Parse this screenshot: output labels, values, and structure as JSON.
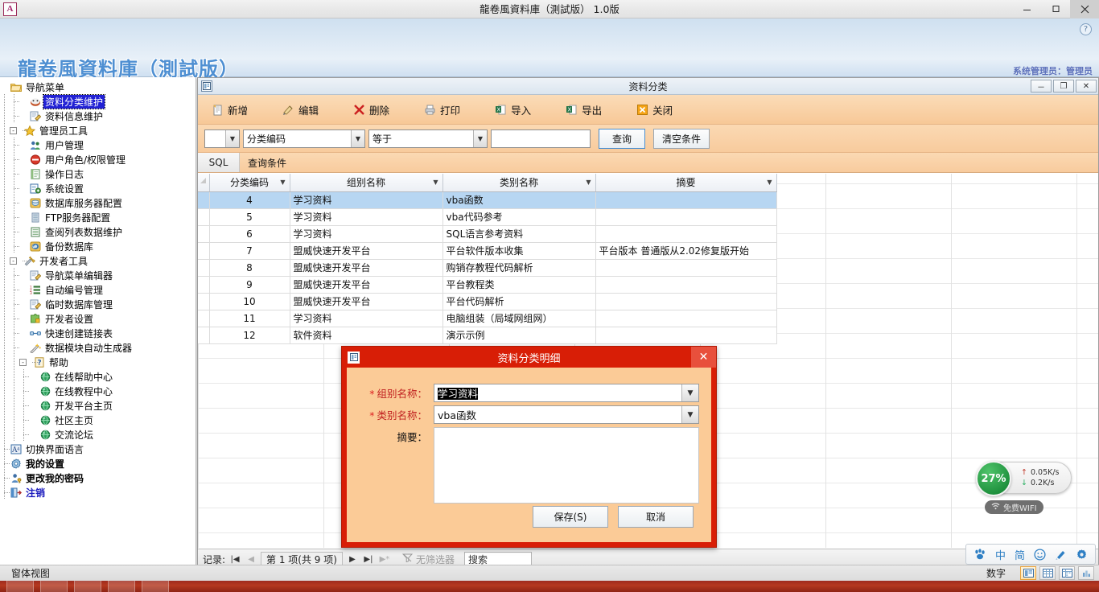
{
  "os_window": {
    "title": "龍卷風資料庫（測試版） 1.0版",
    "app_icon_letter": "A",
    "minimize_label": "最小化",
    "maximize_label": "最大化",
    "close_label": "关闭"
  },
  "app_header": {
    "title": "龍卷風資料庫（測試版）",
    "user_label": "系统管理员：管理员",
    "help_icon": "help-icon"
  },
  "nav": {
    "root": {
      "label": "导航菜单",
      "icon": "folder-icon"
    },
    "items": [
      {
        "label": "资料分类维护",
        "icon": "category-icon",
        "level": 1,
        "selected": true
      },
      {
        "label": "资料信息维护",
        "icon": "edit-doc-icon",
        "level": 1,
        "selected": false
      },
      {
        "label": "管理员工具",
        "icon": "star-icon",
        "level": 0,
        "group": true,
        "expander": "-"
      },
      {
        "label": "用户管理",
        "icon": "users-icon",
        "level": 1
      },
      {
        "label": "用户角色/权限管理",
        "icon": "forbidden-icon",
        "level": 1
      },
      {
        "label": "操作日志",
        "icon": "log-icon",
        "level": 1
      },
      {
        "label": "系统设置",
        "icon": "settings-doc-icon",
        "level": 1
      },
      {
        "label": "数据库服务器配置",
        "icon": "database-icon",
        "level": 1
      },
      {
        "label": "FTP服务器配置",
        "icon": "server-icon",
        "level": 1
      },
      {
        "label": "查阅列表数据维护",
        "icon": "list-icon",
        "level": 1
      },
      {
        "label": "备份数据库",
        "icon": "backup-icon",
        "level": 1
      },
      {
        "label": "开发者工具",
        "icon": "tools-icon",
        "level": 0,
        "group": true,
        "expander": "-"
      },
      {
        "label": "导航菜单编辑器",
        "icon": "edit-doc-icon",
        "level": 1
      },
      {
        "label": "自动编号管理",
        "icon": "number-list-icon",
        "level": 1
      },
      {
        "label": "临时数据库管理",
        "icon": "edit-doc-icon",
        "level": 1
      },
      {
        "label": "开发者设置",
        "icon": "puzzle-icon",
        "level": 1
      },
      {
        "label": "快速创建链接表",
        "icon": "link-icon",
        "level": 1
      },
      {
        "label": "数据模块自动生成器",
        "icon": "wand-icon",
        "level": 1
      },
      {
        "label": "帮助",
        "icon": "question-icon",
        "level": 1,
        "group": true,
        "expander": "-"
      },
      {
        "label": "在线帮助中心",
        "icon": "globe-icon",
        "level": 2
      },
      {
        "label": "在线教程中心",
        "icon": "globe-icon",
        "level": 2
      },
      {
        "label": "开发平台主页",
        "icon": "globe-icon",
        "level": 2
      },
      {
        "label": "社区主页",
        "icon": "globe-icon",
        "level": 2
      },
      {
        "label": "交流论坛",
        "icon": "globe-icon",
        "level": 2
      },
      {
        "label": "切换界面语言",
        "icon": "language-icon",
        "level": 0
      },
      {
        "label": "我的设置",
        "icon": "gear-icon",
        "level": 0,
        "bold": true
      },
      {
        "label": "更改我的密码",
        "icon": "user-key-icon",
        "level": 0,
        "bold": true
      },
      {
        "label": "注销",
        "icon": "logout-icon",
        "level": 0,
        "bold": true,
        "link": true
      }
    ]
  },
  "mdi": {
    "title": "资料分类",
    "icon": "form-icon",
    "minimize": "－",
    "restore": "❐",
    "close": "✕"
  },
  "toolbar": {
    "items": [
      {
        "label": "新增",
        "icon": "new-record-icon"
      },
      {
        "label": "编辑",
        "icon": "edit-icon"
      },
      {
        "label": "删除",
        "icon": "delete-icon"
      },
      {
        "label": "打印",
        "icon": "print-icon"
      },
      {
        "label": "导入",
        "icon": "import-excel-icon"
      },
      {
        "label": "导出",
        "icon": "export-excel-icon"
      },
      {
        "label": "关闭",
        "icon": "close-x-icon"
      }
    ]
  },
  "filterbar": {
    "logic_value": "",
    "field_value": "分类编码",
    "operator_value": "等于",
    "criteria_value": "",
    "criteria_placeholder": "",
    "query_button": "查询",
    "clear_button": "清空条件"
  },
  "sqlbar": {
    "tab_label": "SQL",
    "text": "查询条件"
  },
  "grid": {
    "columns": [
      "分类编码",
      "组别名称",
      "类别名称",
      "摘要"
    ],
    "rows": [
      {
        "cells": [
          "4",
          "学习资料",
          "vba函数",
          ""
        ],
        "selected": true
      },
      {
        "cells": [
          "5",
          "学习资料",
          "vba代码参考",
          ""
        ],
        "selected": false
      },
      {
        "cells": [
          "6",
          "学习资料",
          "SQL语言参考资料",
          ""
        ],
        "selected": false
      },
      {
        "cells": [
          "7",
          "盟威快速开发平台",
          "平台软件版本收集",
          "平台版本  普通版从2.02修复版开始"
        ],
        "selected": false
      },
      {
        "cells": [
          "8",
          "盟威快速开发平台",
          "购销存教程代码解析",
          ""
        ],
        "selected": false
      },
      {
        "cells": [
          "9",
          "盟威快速开发平台",
          "平台教程类",
          ""
        ],
        "selected": false
      },
      {
        "cells": [
          "10",
          "盟威快速开发平台",
          "平台代码解析",
          ""
        ],
        "selected": false
      },
      {
        "cells": [
          "11",
          "学习资料",
          "电脑组装（局域网组网）",
          ""
        ],
        "selected": false
      },
      {
        "cells": [
          "12",
          "软件资料",
          "演示示例",
          ""
        ],
        "selected": false
      }
    ]
  },
  "recnav": {
    "label": "记录:",
    "first": "|◀",
    "prev": "◀",
    "position": "第 1 项(共 9 项)",
    "next": "▶",
    "last": "▶|",
    "new": "▶*",
    "filter_text": "无筛选器",
    "filter_icon": "filter-icon",
    "search_value": "搜索"
  },
  "modal": {
    "title": "资料分类明细",
    "icon": "form-icon",
    "close": "✕",
    "fields": [
      {
        "required": "*",
        "label": "组别名称：",
        "value": "学习资料",
        "highlighted": true,
        "type": "combo"
      },
      {
        "required": "*",
        "label": "类别名称：",
        "value": "vba函数",
        "highlighted": false,
        "type": "combo"
      },
      {
        "required": "",
        "label": "摘要：",
        "value": "",
        "type": "textarea"
      }
    ],
    "save_button": "保存(S)",
    "cancel_button": "取消"
  },
  "net_widget": {
    "percent": "27%",
    "upload": "0.05K/s",
    "download": "0.2K/s",
    "wifi_label": "免费WIFI",
    "wifi_icon": "wifi-icon"
  },
  "ime_bar": {
    "items": [
      {
        "label": "",
        "icon": "baidu-paw-icon"
      },
      {
        "label": "中",
        "icon": "chinese-mode-icon"
      },
      {
        "label": "简",
        "icon": "simplified-icon"
      },
      {
        "label": "",
        "icon": "smiley-icon"
      },
      {
        "label": "",
        "icon": "pen-icon"
      },
      {
        "label": "",
        "icon": "gear-icon"
      }
    ]
  },
  "statusbar": {
    "left_text": "窗体视图",
    "num_lock": "数字",
    "view_buttons": [
      {
        "icon": "form-view-icon",
        "active": true
      },
      {
        "icon": "datasheet-view-icon",
        "active": false
      },
      {
        "icon": "pivot-table-icon",
        "active": false
      },
      {
        "icon": "pivot-chart-icon",
        "active": false
      }
    ]
  },
  "colors": {
    "accent_blue": "#4e8fd2",
    "toolbar_orange": "#f8cb97",
    "modal_red": "#d81e06",
    "selection_blue": "#b7d6f2",
    "nav_selection": "#2121d4"
  }
}
